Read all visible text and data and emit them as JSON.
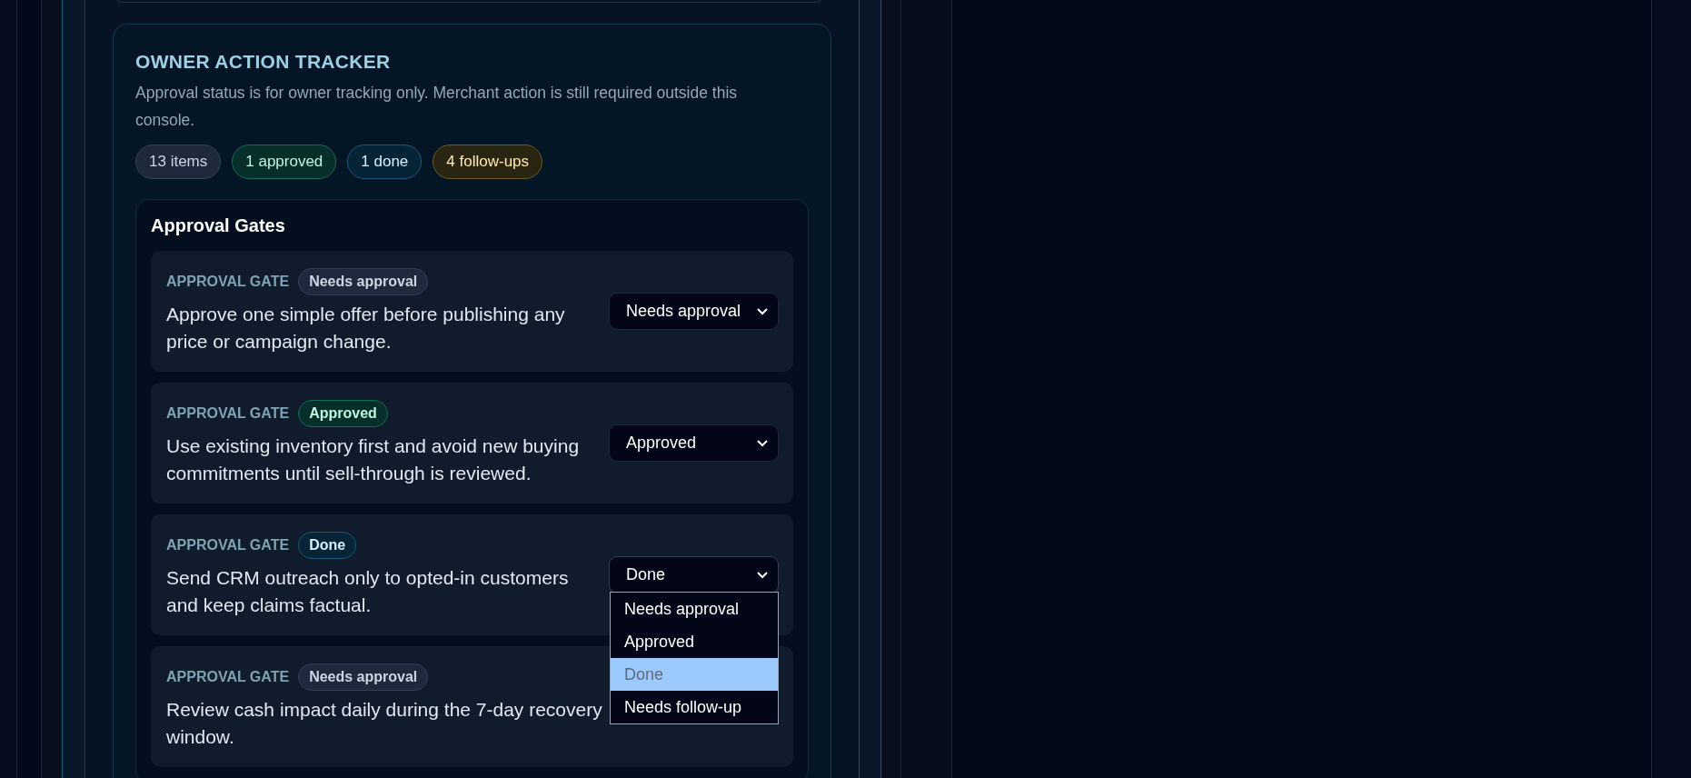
{
  "tracker": {
    "title": "OWNER ACTION TRACKER",
    "description": "Approval status is for owner tracking only. Merchant action is still required outside this console.",
    "summary": [
      {
        "text": "13 items",
        "kind": "neutral"
      },
      {
        "text": "1 approved",
        "kind": "approved"
      },
      {
        "text": "1 done",
        "kind": "done"
      },
      {
        "text": "4 follow-ups",
        "kind": "followup"
      }
    ],
    "section_title": "Approval Gates",
    "gates": [
      {
        "label": "APPROVAL GATE",
        "badge": {
          "text": "Needs approval",
          "kind": "neutral"
        },
        "text": "Approve one simple offer before publishing any price or campaign change.",
        "select": {
          "value": "Needs approval",
          "open": false
        }
      },
      {
        "label": "APPROVAL GATE",
        "badge": {
          "text": "Approved",
          "kind": "approved"
        },
        "text": "Use existing inventory first and avoid new buying commitments until sell-through is reviewed.",
        "select": {
          "value": "Approved",
          "open": false
        }
      },
      {
        "label": "APPROVAL GATE",
        "badge": {
          "text": "Done",
          "kind": "done"
        },
        "text": "Send CRM outreach only to opted-in customers and keep claims factual.",
        "select": {
          "value": "Done",
          "open": true,
          "options": [
            {
              "text": "Needs approval",
              "selected": false
            },
            {
              "text": "Approved",
              "selected": false
            },
            {
              "text": "Done",
              "selected": true
            },
            {
              "text": "Needs follow-up",
              "selected": false
            }
          ]
        }
      },
      {
        "label": "APPROVAL GATE",
        "badge": {
          "text": "Needs approval",
          "kind": "neutral"
        },
        "text": "Review cash impact daily during the 7-day recovery window."
      }
    ]
  }
}
